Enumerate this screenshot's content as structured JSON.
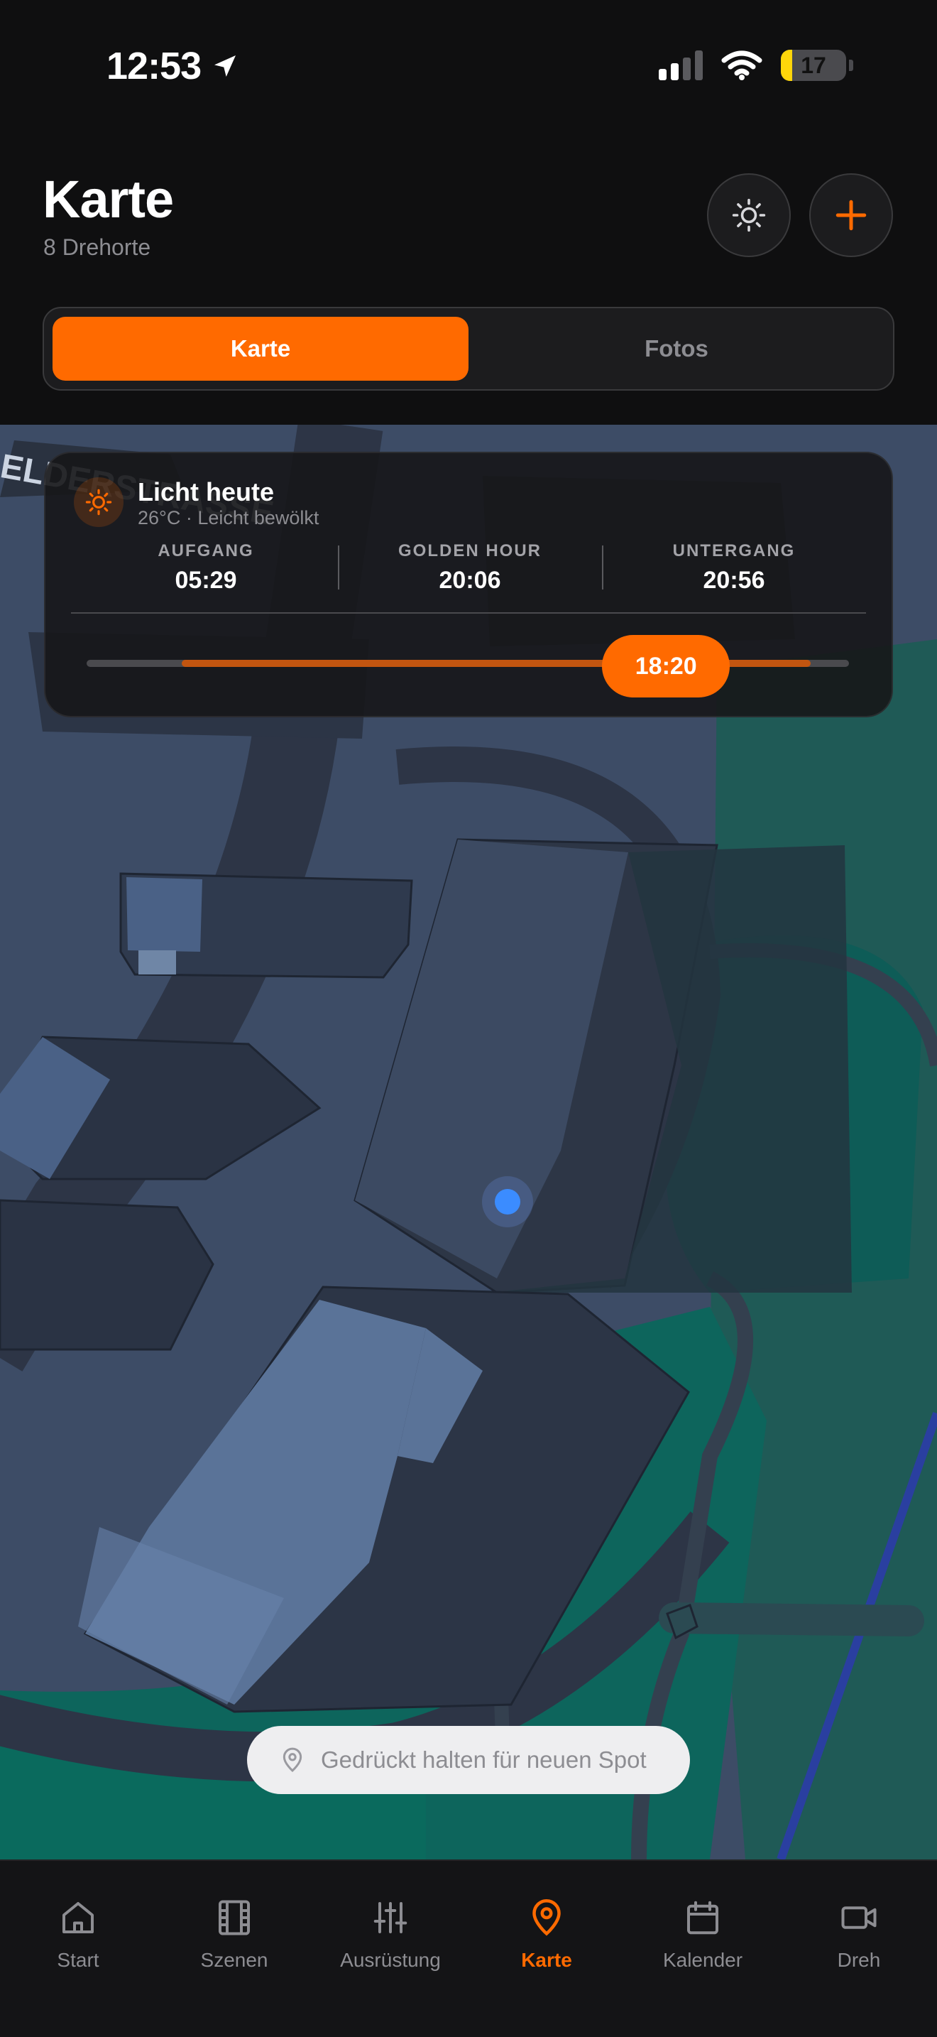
{
  "status_bar": {
    "time": "12:53",
    "battery": "17",
    "icons": [
      "location-arrow-icon",
      "signal-icon",
      "wifi-icon",
      "battery-icon"
    ]
  },
  "header": {
    "title": "Karte",
    "subtitle": "8 Drehorte",
    "buttons": [
      "sun-icon",
      "plus-icon"
    ]
  },
  "segmented": {
    "options": [
      "Karte",
      "Fotos"
    ],
    "selected": "Karte"
  },
  "map": {
    "street_label": "ELDERSTRASSE"
  },
  "light_card": {
    "title": "Licht heute",
    "subtitle": "26°C · Leicht bewölkt",
    "stats": [
      {
        "label": "AUFGANG",
        "value": "05:29"
      },
      {
        "label": "GOLDEN HOUR",
        "value": "20:06"
      },
      {
        "label": "UNTERGANG",
        "value": "20:56"
      }
    ],
    "slider": {
      "current": "18:20",
      "position": 0.76,
      "range_start": 0.125,
      "range_end": 0.95
    }
  },
  "hint": {
    "text": "Gedrückt halten für neuen Spot"
  },
  "tab_bar": {
    "items": [
      {
        "label": "Start",
        "icon": "home-icon"
      },
      {
        "label": "Szenen",
        "icon": "film-icon"
      },
      {
        "label": "Ausrüstung",
        "icon": "sliders-icon"
      },
      {
        "label": "Karte",
        "icon": "map-pin-icon"
      },
      {
        "label": "Kalender",
        "icon": "calendar-icon"
      },
      {
        "label": "Dreh",
        "icon": "video-icon"
      }
    ],
    "active": "Karte"
  },
  "colors": {
    "accent": "#ff6a00",
    "background": "#0f0f10",
    "map_base": "#3d4c66",
    "map_green": "#0f6a5f"
  }
}
